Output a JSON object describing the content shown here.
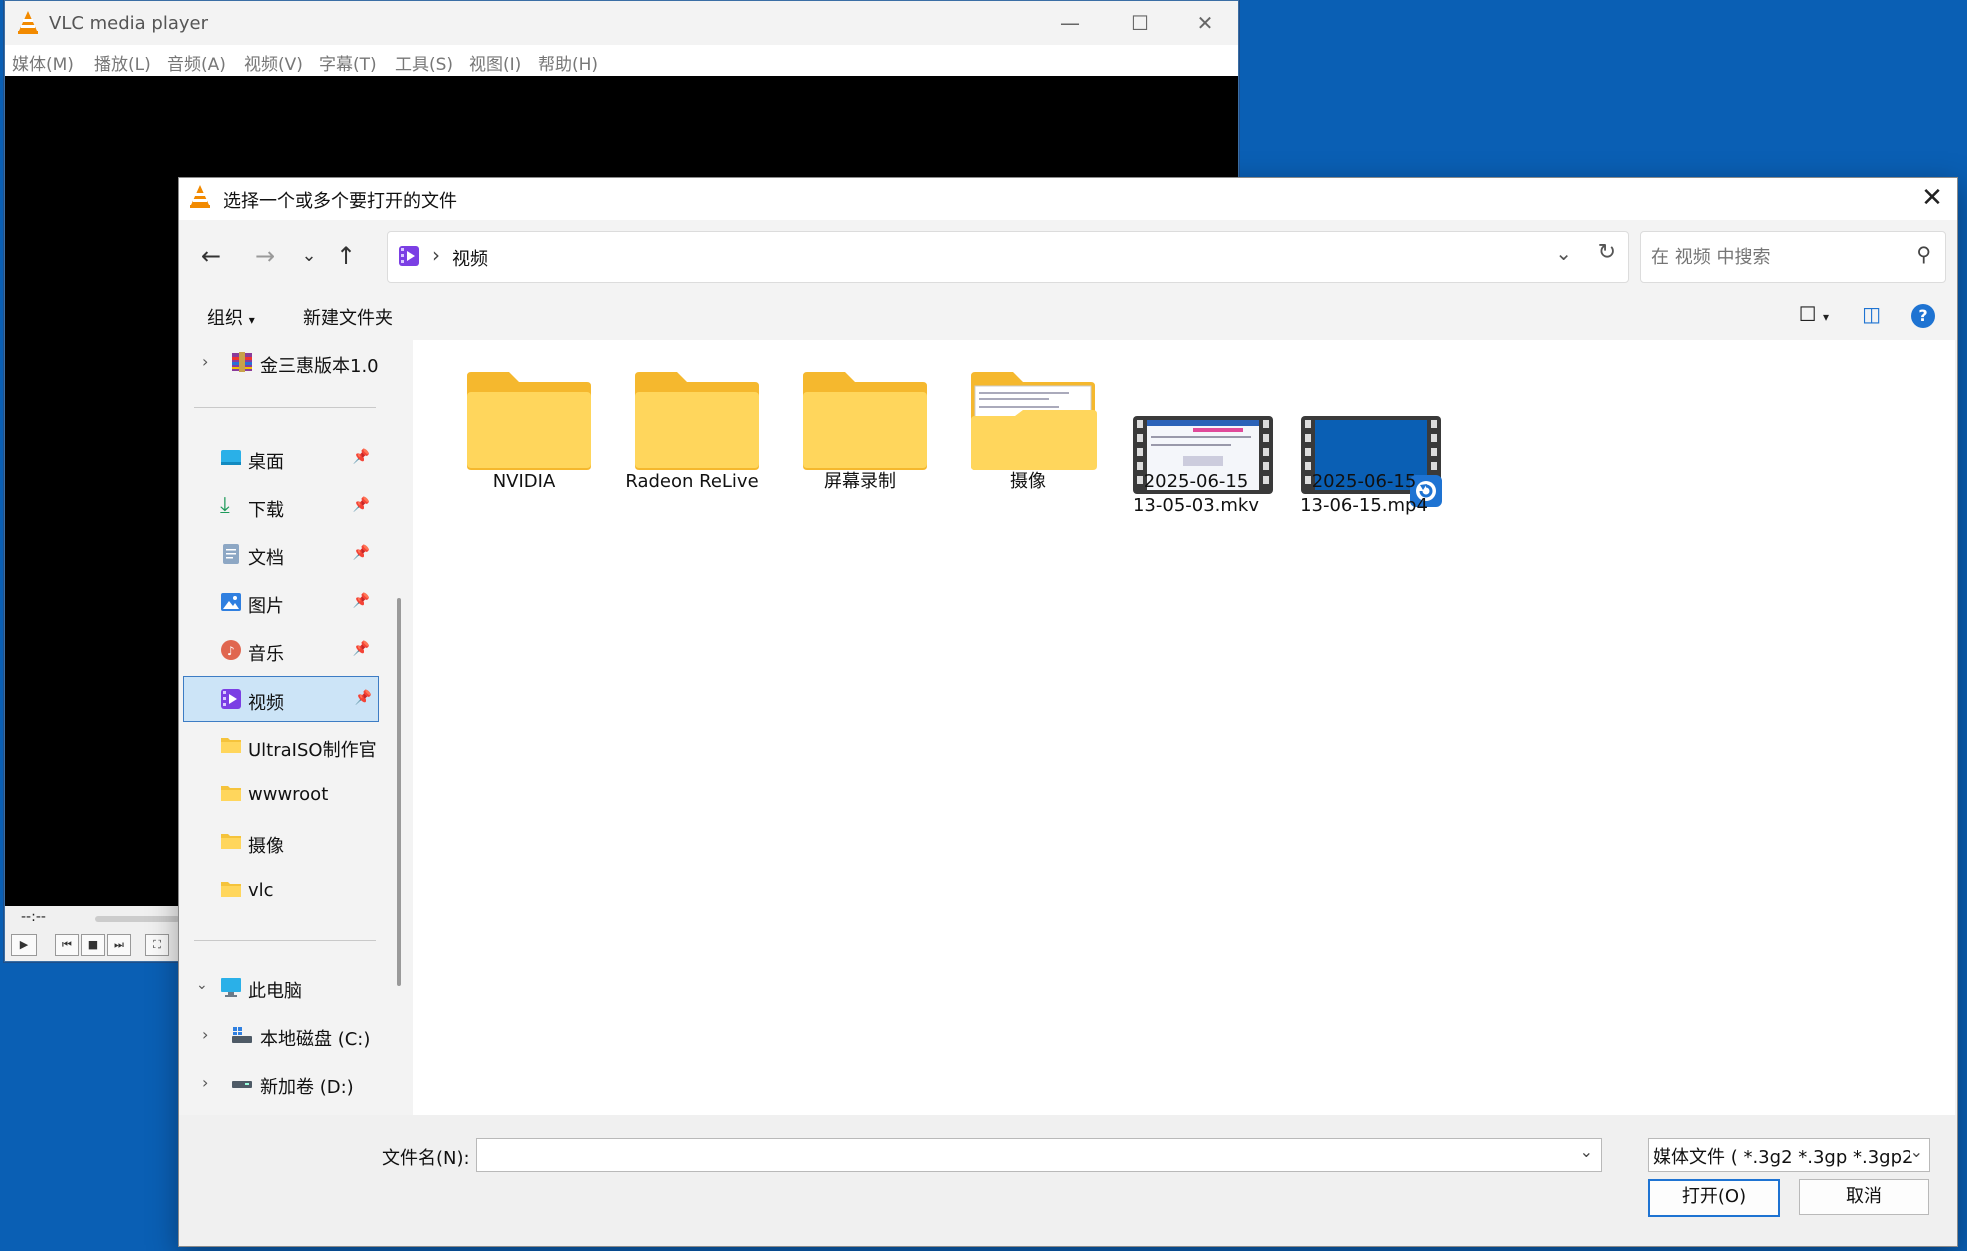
{
  "vlc": {
    "title": "VLC media player",
    "menu": [
      "媒体(M)",
      "播放(L)",
      "音频(A)",
      "视频(V)",
      "字幕(T)",
      "工具(S)",
      "视图(I)",
      "帮助(H)"
    ],
    "time": "--:--"
  },
  "dialog": {
    "title": "选择一个或多个要打开的文件",
    "breadcrumb": "视频",
    "search_placeholder": "在 视频 中搜索",
    "organize_label": "组织",
    "new_folder_label": "新建文件夹",
    "nav": {
      "top_item": "金三惠版本1.0",
      "quick_access": [
        {
          "label": "桌面",
          "icon": "desktop-icon",
          "pinned": true
        },
        {
          "label": "下载",
          "icon": "download-icon",
          "pinned": true
        },
        {
          "label": "文档",
          "icon": "document-icon",
          "pinned": true
        },
        {
          "label": "图片",
          "icon": "pictures-icon",
          "pinned": true
        },
        {
          "label": "音乐",
          "icon": "music-icon",
          "pinned": true
        },
        {
          "label": "视频",
          "icon": "videos-icon",
          "pinned": true,
          "selected": true
        },
        {
          "label": "UltraISO制作官",
          "icon": "folder-icon"
        },
        {
          "label": "wwwroot",
          "icon": "folder-icon"
        },
        {
          "label": "摄像",
          "icon": "folder-icon"
        },
        {
          "label": "vlc",
          "icon": "folder-icon"
        }
      ],
      "this_pc": "此电脑",
      "drives": [
        "本地磁盘 (C:)",
        "新加卷 (D:)"
      ]
    },
    "items": [
      {
        "name": "NVIDIA",
        "type": "folder"
      },
      {
        "name": "Radeon ReLive",
        "type": "folder"
      },
      {
        "name": "屏幕录制",
        "type": "folder"
      },
      {
        "name": "摄像",
        "type": "folder-with-content"
      },
      {
        "name_line1": "2025-06-15",
        "name_line2": "13-05-03.mkv",
        "type": "video"
      },
      {
        "name_line1": "2025-06-15",
        "name_line2": "13-06-15.mp4",
        "type": "video"
      }
    ],
    "filename_label": "文件名(N):",
    "filename_value": "",
    "filetype_value": "媒体文件 ( *.3g2 *.3gp *.3gp2",
    "open_label": "打开(O)",
    "cancel_label": "取消"
  }
}
